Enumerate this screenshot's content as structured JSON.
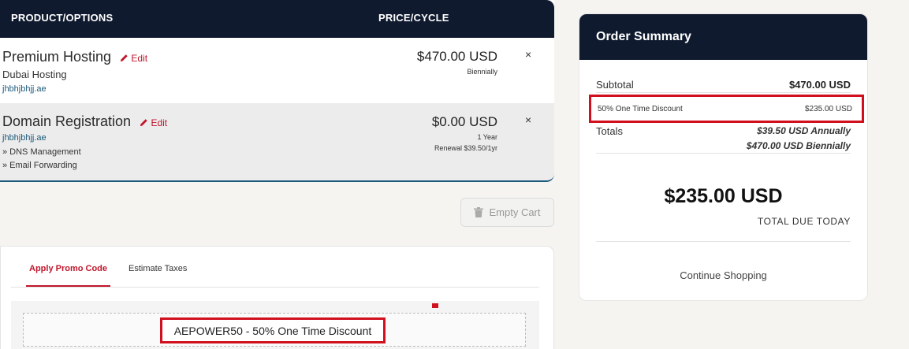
{
  "cart": {
    "header": {
      "product": "PRODUCT/OPTIONS",
      "price": "PRICE/CYCLE"
    },
    "edit_label": "Edit",
    "remove_symbol": "×",
    "items": [
      {
        "name": "Premium Hosting",
        "subtitle": "Dubai Hosting",
        "domain": "jhbhjbhjj.ae",
        "price": "$470.00 USD",
        "cycle": "Biennially"
      },
      {
        "name": "Domain Registration",
        "domain": "jhbhjbhjj.ae",
        "addons": [
          "» DNS Management",
          "» Email Forwarding"
        ],
        "price": "$0.00 USD",
        "cycle": "1 Year",
        "renewal": "Renewal $39.50/1yr"
      }
    ],
    "empty_cart_label": "Empty Cart"
  },
  "promo": {
    "tabs": [
      {
        "label": "Apply Promo Code",
        "active": true
      },
      {
        "label": "Estimate Taxes",
        "active": false
      }
    ],
    "applied_code": "AEPOWER50 - 50% One Time Discount"
  },
  "summary": {
    "title": "Order Summary",
    "subtotal_label": "Subtotal",
    "subtotal_value": "$470.00 USD",
    "discount_label": "50% One Time Discount",
    "discount_value": "$235.00 USD",
    "totals_label": "Totals",
    "totals_annual": "$39.50 USD Annually",
    "totals_biennial": "$470.00 USD Biennially",
    "due_amount": "$235.00 USD",
    "due_label": "TOTAL DUE TODAY",
    "continue_label": "Continue Shopping"
  },
  "colors": {
    "header_bg": "#0f1a2e",
    "accent_red": "#c0162c",
    "highlight_red": "#d0101e",
    "link_blue": "#1b5a7a"
  }
}
